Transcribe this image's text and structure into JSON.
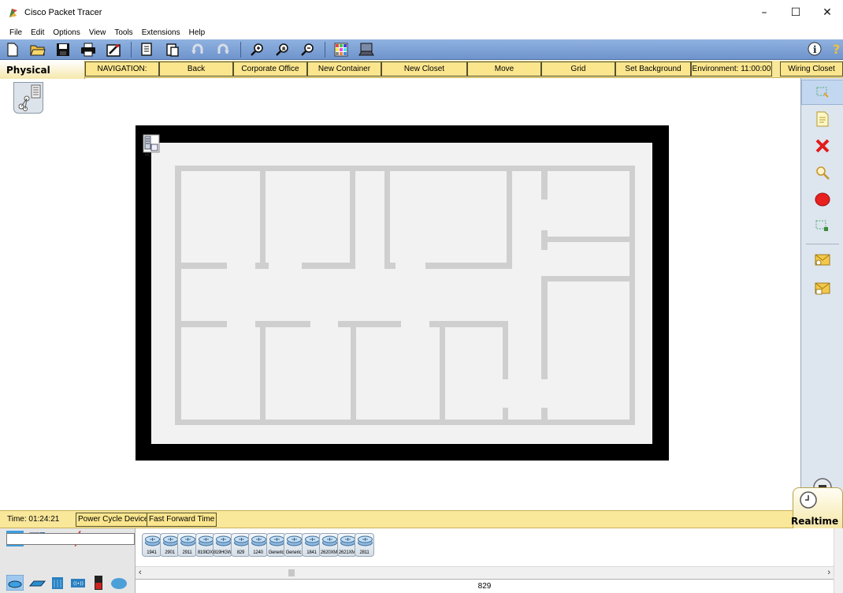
{
  "window": {
    "title": "Cisco Packet Tracer",
    "controls": {
      "minimize": "–",
      "maximize": "☐",
      "close": "✕"
    }
  },
  "menubar": [
    "File",
    "Edit",
    "Options",
    "View",
    "Tools",
    "Extensions",
    "Help"
  ],
  "toolbar": {
    "icons": [
      "new-icon",
      "open-icon",
      "save-icon",
      "print-icon",
      "activity-wizard-icon",
      "copy-icon",
      "paste-icon",
      "undo-icon",
      "redo-icon",
      "zoom-in-icon",
      "zoom-reset-icon",
      "zoom-out-icon",
      "palette-icon",
      "custom-device-icon"
    ],
    "right_icons": [
      "info-icon",
      "help-icon"
    ]
  },
  "physical_nav": {
    "tab": "Physical",
    "buttons": [
      "NAVIGATION:",
      "Back",
      "Corporate Office",
      "New Container",
      "New Closet",
      "Move",
      "Grid",
      "Set Background",
      "Environment: 11:00:00",
      "Wiring Closet"
    ]
  },
  "right_palette": [
    "select-icon",
    "note-icon",
    "delete-icon",
    "inspect-icon",
    "draw-ellipse-icon",
    "resize-icon",
    "simple-pdu-icon",
    "complex-pdu-icon"
  ],
  "statusbar": {
    "time": "Time: 01:24:21",
    "power_cycle": "Power Cycle Devices",
    "fast_forward": "Fast Forward Time",
    "mode": "Realtime"
  },
  "devices": {
    "models": [
      "1941",
      "2901",
      "2911",
      "819IOX",
      "819HGW",
      "829",
      "1240",
      "Generic",
      "Generic",
      "1841",
      "2620XM",
      "2621XM",
      "2811"
    ],
    "selected_label": "829",
    "search_value": ""
  },
  "colors": {
    "toolbar": "#7aa0d6",
    "nav_bar": "#f9e79a",
    "floor": "#f2f2f2",
    "walls": "#cfcfcf",
    "border": "#000000"
  }
}
